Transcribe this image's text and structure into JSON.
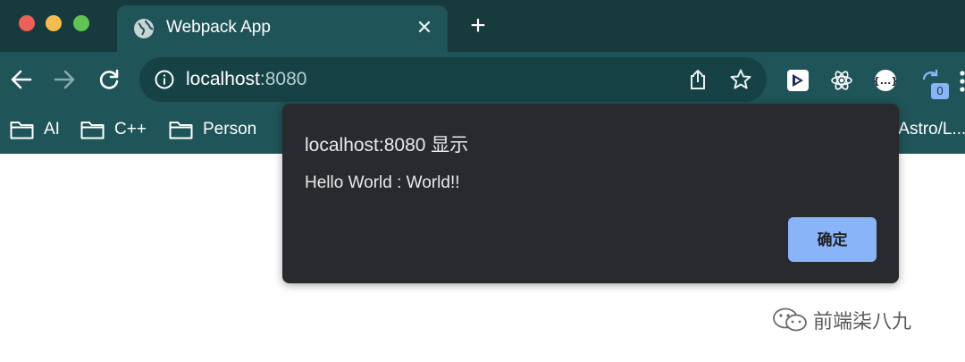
{
  "browser": {
    "tab": {
      "title": "Webpack App",
      "close_glyph": "✕"
    },
    "new_tab_glyph": "+",
    "address_bar": {
      "host": "localhost",
      "port_suffix": ":8080"
    },
    "extension_badge": "0",
    "bookmarks": [
      {
        "label": "AI",
        "icon": "folder-icon"
      },
      {
        "label": "C++",
        "icon": "folder-icon"
      },
      {
        "label": "Person",
        "icon": "folder-icon"
      }
    ],
    "bookmark_overflow_text": "/Astro/L..."
  },
  "alert_dialog": {
    "title": "localhost:8080 显示",
    "message": "Hello World : World!!",
    "ok_label": "确定"
  },
  "watermark": {
    "text": "前端柒八九"
  },
  "colors": {
    "titlebar": "#173a3d",
    "toolbar": "#1f5458",
    "dialog_bg": "#292a2d",
    "ok_button": "#8ab4f8"
  }
}
